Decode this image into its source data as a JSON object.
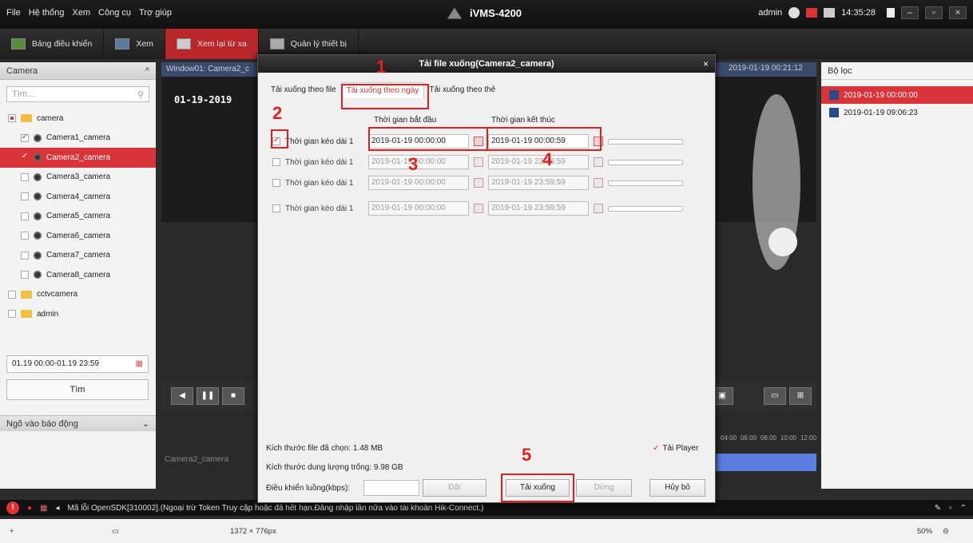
{
  "menu": [
    "File",
    "Hệ thống",
    "Xem",
    "Công cụ",
    "Trợ giúp"
  ],
  "app_title": "iVMS-4200",
  "user": "admin",
  "clock": "14:35:28",
  "tabs": [
    "Bảng điều khiển",
    "Xem",
    "Xem lại từ xa",
    "Quản lý thiết bị"
  ],
  "left_panel": {
    "header": "Camera",
    "search_placeholder": "Tìm...",
    "tree": [
      {
        "label": "camera",
        "level": 0,
        "state": "partial"
      },
      {
        "label": "Camera1_camera",
        "level": 1,
        "state": "checked"
      },
      {
        "label": "Camera2_camera",
        "level": 1,
        "state": "selected"
      },
      {
        "label": "Camera3_camera",
        "level": 1,
        "state": "none"
      },
      {
        "label": "Camera4_camera",
        "level": 1,
        "state": "none"
      },
      {
        "label": "Camera5_camera",
        "level": 1,
        "state": "none"
      },
      {
        "label": "Camera6_camera",
        "level": 1,
        "state": "none"
      },
      {
        "label": "Camera7_camera",
        "level": 1,
        "state": "none"
      },
      {
        "label": "Camera8_camera",
        "level": 1,
        "state": "none"
      },
      {
        "label": "cctvcamera",
        "level": 0,
        "state": "none"
      },
      {
        "label": "admin",
        "level": 0,
        "state": "none"
      }
    ],
    "date_range": "01.19 00:00-01.19 23:59",
    "search_button": "Tìm",
    "alarm_header": "Ngõ vào báo động"
  },
  "video": {
    "window_label": "Window01: Camera2_c",
    "overlay_date": "01-19-2019",
    "right_stamp": "2019-01-19 00:21:12",
    "timeline_label": "Camera2_camera",
    "timeline_ticks": [
      "04:00",
      "06:00",
      "08:00",
      "10:00",
      "12:00"
    ]
  },
  "right_panel": {
    "header": "Bộ lọc",
    "files": [
      "2019-01-19 00:00:00",
      "2019-01-19 09:06:23"
    ]
  },
  "dialog": {
    "title": "Tải file xuống(Camera2_camera)",
    "tabs": [
      "Tải xuống theo file",
      "Tải xuống theo ngày",
      "Tải xuống theo thẻ"
    ],
    "col_start": "Thời gian bắt đầu",
    "col_end": "Thời gian kết thúc",
    "rows": [
      {
        "label": "Thời gian kéo dài 1",
        "start": "2019-01-19 00:00:00",
        "end": "2019-01-19 00:00:59",
        "checked": true
      },
      {
        "label": "Thời gian kéo dài 1",
        "start": "2019-01-19 00:00:00",
        "end": "2019-01-19 23:59:59",
        "checked": false
      },
      {
        "label": "Thời gian kéo dài 1",
        "start": "2019-01-19 00:00:00",
        "end": "2019-01-19 23:59:59",
        "checked": false
      },
      {
        "label": "Thời gian kéo dài 1",
        "start": "2019-01-19 00:00:00",
        "end": "2019-01-19 23:59:59",
        "checked": false
      }
    ],
    "selected_size": "Kích thước file đã chọn: 1.48 MB",
    "free_space": "Kích thước dung lượng trống: 9.98 GB",
    "flow_label": "Điều khiển luồng(kbps):",
    "tai_player": "Tải Player",
    "btn_set": "Đặt",
    "btn_download": "Tải xuống",
    "btn_stop": "Dừng",
    "btn_cancel": "Hủy bỏ"
  },
  "annotations": [
    "1",
    "2",
    "3",
    "4",
    "5"
  ],
  "status_message": "Mã lỗi OpenSDK[310002].(Ngoại trừ Token Truy cập hoặc đã hết hạn.Đăng nhập lần nữa vào tài khoản Hik-Connect.)",
  "image_size": "1372 × 776px",
  "zoom": "50%"
}
